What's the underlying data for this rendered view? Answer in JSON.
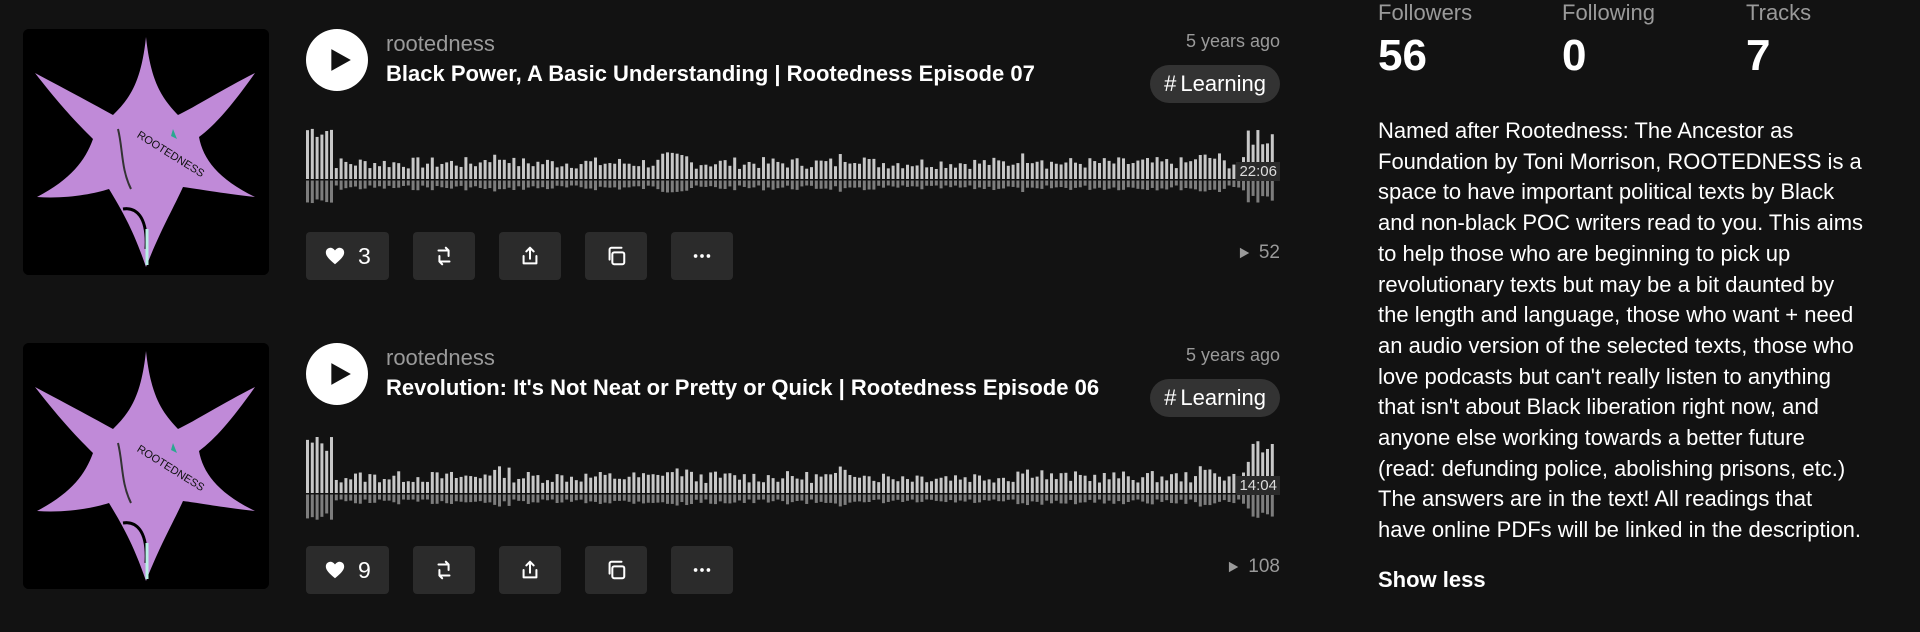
{
  "tracks": [
    {
      "username": "rootedness",
      "title": "Black Power, A Basic Understanding | Rootedness Episode 07",
      "age": "5 years ago",
      "tag": "Learning",
      "duration": "22:06",
      "likes": "3",
      "plays": "52"
    },
    {
      "username": "rootedness",
      "title": "Revolution: It's Not Neat or Pretty or Quick | Rootedness Episode 06",
      "age": "5 years ago",
      "tag": "Learning",
      "duration": "14:04",
      "likes": "9",
      "plays": "108"
    }
  ],
  "profile": {
    "followers_label": "Followers",
    "followers": "56",
    "following_label": "Following",
    "following": "0",
    "tracks_label": "Tracks",
    "tracks": "7",
    "bio": "Named after Rootedness: The Ancestor as\nFoundation by Toni Morrison, ROOTEDNESS is a\nspace to have important political texts by Black\nand non-black POC writers read to you. This aims\nto help those who are beginning to pick up\nrevolutionary texts but may be a bit daunted by\nthe length and language, those who want + need\nan audio version of the selected texts, those who\nlove podcasts but can't really listen to anything\nthat isn't about Black liberation right now, and\nanyone else working towards a better future\n(read: defunding police, abolishing prisons, etc.)\nThe answers are in the text! All readings that\nhave online PDFs will be linked in the description.",
    "show_less": "Show less"
  },
  "artwork_text": "ROOTEDNESS",
  "icons": {
    "play": "play-icon",
    "like": "heart-icon",
    "repost": "repost-icon",
    "share": "share-icon",
    "copy": "copy-icon",
    "more": "more-icon",
    "plays": "play-count-icon"
  },
  "colors": {
    "background": "#121212",
    "button": "#2b2b2b",
    "artwork": "#c08ad8"
  }
}
